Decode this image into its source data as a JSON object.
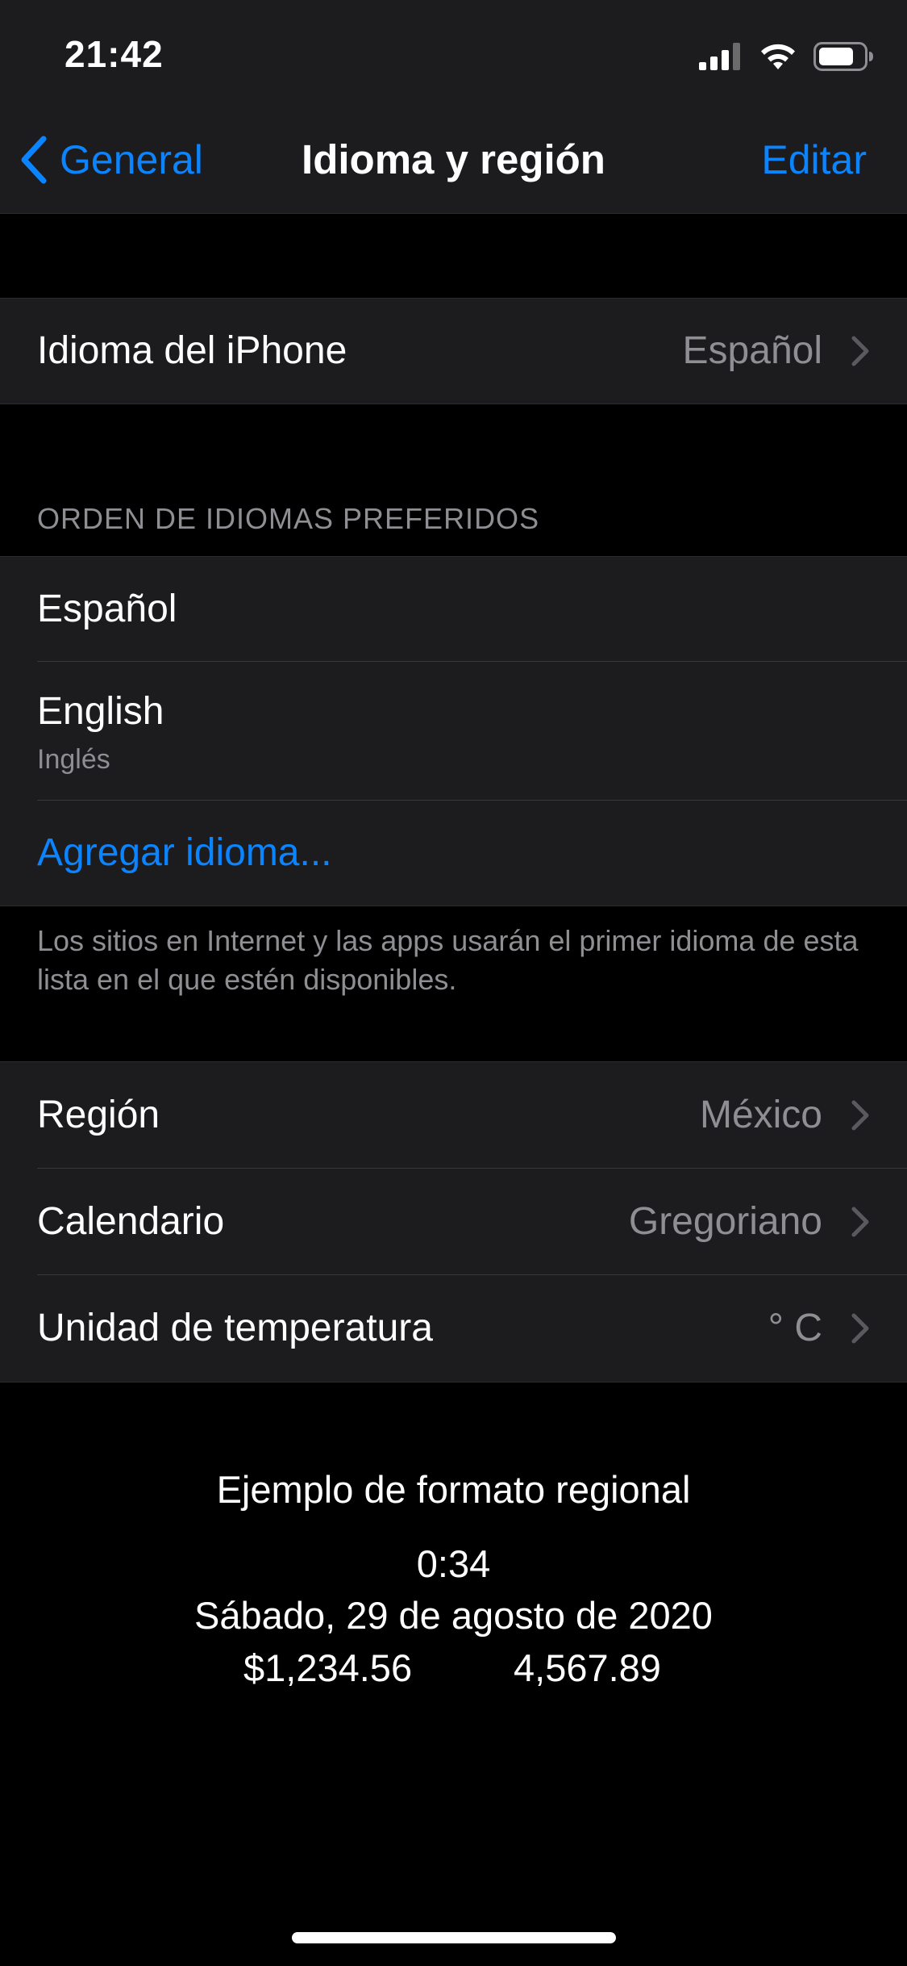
{
  "status_bar": {
    "time": "21:42",
    "icons": [
      "cellular-signal-icon",
      "wifi-icon",
      "battery-icon"
    ]
  },
  "nav": {
    "back_label": "General",
    "title": "Idioma y región",
    "edit_label": "Editar"
  },
  "iphone_language": {
    "label": "Idioma del iPhone",
    "value": "Español"
  },
  "preferred_languages": {
    "header": "ORDEN DE IDIOMAS PREFERIDOS",
    "items": [
      {
        "label": "Español",
        "sublabel": ""
      },
      {
        "label": "English",
        "sublabel": "Inglés"
      }
    ],
    "add_label": "Agregar idioma...",
    "footer": "Los sitios en Internet y las apps usarán el primer idioma de esta lista en el que estén disponibles."
  },
  "regional_settings": [
    {
      "label": "Región",
      "value": "México"
    },
    {
      "label": "Calendario",
      "value": "Gregoriano"
    },
    {
      "label": "Unidad de temperatura",
      "value": "° C"
    }
  ],
  "format_example": {
    "title": "Ejemplo de formato regional",
    "time": "0:34",
    "date": "Sábado, 29 de agosto de 2020",
    "currency": "$1,234.56",
    "number": "4,567.89"
  },
  "colors": {
    "accent": "#0a84ff",
    "background": "#000000",
    "cell_background": "#1c1c1e",
    "secondary_text": "#8e8e93"
  }
}
